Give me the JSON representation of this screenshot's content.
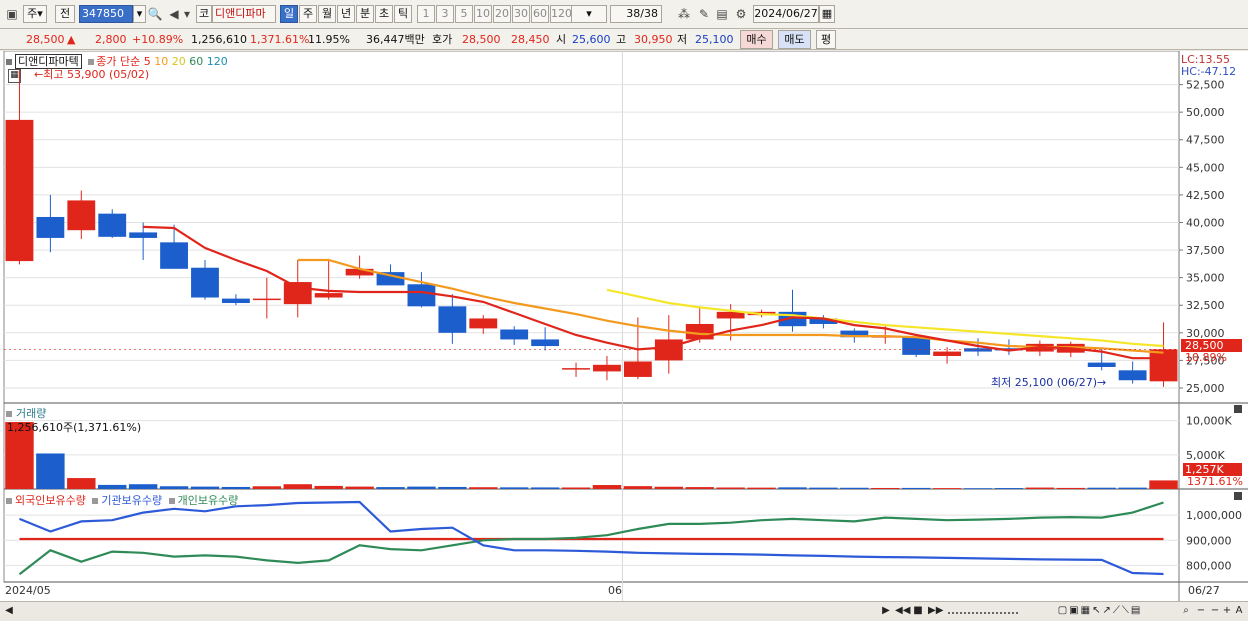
{
  "toolbar": {
    "period_label": "주",
    "prev_label": "전",
    "code_value": "347850",
    "market_label": "코",
    "stock_name": "디앤디파마",
    "timeframes": [
      "일",
      "주",
      "월",
      "년",
      "분",
      "초",
      "틱"
    ],
    "active_timeframe": "일",
    "intervals": [
      "1",
      "3",
      "5",
      "10",
      "20",
      "30",
      "60",
      "120"
    ],
    "count_display": "38/38",
    "date_value": "2024/06/27"
  },
  "quote": {
    "price": "28,500",
    "change": "2,800",
    "change_pct": "+10.89%",
    "volume": "1,256,610",
    "volume_pct": "1,371.61%",
    "turnover": "11.95%",
    "amount": "36,447백만",
    "bid_label": "호가",
    "bid1": "28,500",
    "bid2": "28,450",
    "open_label": "시",
    "open": "25,600",
    "high_label": "고",
    "high": "30,950",
    "low_label": "저",
    "low": "25,100",
    "buy_label": "매수",
    "sell_label": "매도",
    "eval_label": "평"
  },
  "legend": {
    "stock": "디앤디파마텍",
    "ma_label": "종가 단순",
    "ma_periods": [
      "5",
      "10",
      "20",
      "60",
      "120"
    ],
    "max_note": "최고 53,900 (05/02)",
    "min_note": "최저 25,100 (06/27)",
    "lc": "LC:13.55",
    "hc": "HC:-47.12",
    "last_price_tag": "28,500",
    "last_pct_tag": "10.89%",
    "volume_title": "거래량",
    "volume_note": "1,256,610주(1,371.61%)",
    "vol_tag": "1,257K",
    "vol_pct_tag": "1371.61%",
    "holdings": [
      "외국인보유수량",
      "기관보유수량",
      "개인보유수량"
    ]
  },
  "axis": {
    "price_ticks": [
      "52,500",
      "50,000",
      "47,500",
      "45,000",
      "42,500",
      "40,000",
      "37,500",
      "35,000",
      "32,500",
      "30,000",
      "27,500",
      "25,000"
    ],
    "volume_ticks": [
      "10,000K",
      "5,000K"
    ],
    "holding_ticks": [
      "1,000,000",
      "900,000",
      "800,000"
    ],
    "date_left": "2024/05",
    "date_mid": "06",
    "date_right": "06/27"
  },
  "colors": {
    "up": "#e0261b",
    "down": "#1c5fcc",
    "ma5": "#e0261b",
    "ma10": "#f39a1e",
    "ma20": "#f5e62a",
    "ma60": "#2e8b57",
    "ma120": "#1c8fb0",
    "foreign": "#2d5ad8",
    "institution": "#e0261b",
    "individual": "#2e8b57"
  },
  "chart_data": {
    "type": "candlestick",
    "dates": [
      "05/02",
      "05/03",
      "05/07",
      "05/08",
      "05/09",
      "05/10",
      "05/13",
      "05/14",
      "05/16",
      "05/17",
      "05/20",
      "05/21",
      "05/22",
      "05/23",
      "05/24",
      "05/27",
      "05/28",
      "05/29",
      "05/30",
      "05/31",
      "06/03",
      "06/04",
      "06/05",
      "06/07",
      "06/10",
      "06/11",
      "06/12",
      "06/13",
      "06/14",
      "06/17",
      "06/18",
      "06/19",
      "06/20",
      "06/21",
      "06/24",
      "06/25",
      "06/26",
      "06/27"
    ],
    "open": [
      36500,
      40500,
      39300,
      40800,
      39100,
      38200,
      35900,
      33100,
      33000,
      32600,
      33200,
      35200,
      35500,
      34400,
      32400,
      30400,
      30300,
      29400,
      26700,
      26500,
      26000,
      27500,
      29400,
      31300,
      31600,
      31900,
      31300,
      30200,
      29700,
      29600,
      27900,
      28600,
      28600,
      28300,
      28200,
      27300,
      26600,
      25600
    ],
    "high": [
      53900,
      42500,
      42900,
      41200,
      40000,
      39800,
      36600,
      33500,
      35000,
      36600,
      36700,
      37000,
      36200,
      35500,
      33500,
      31600,
      30600,
      30500,
      27300,
      27900,
      31400,
      31600,
      32400,
      32600,
      32100,
      33900,
      31600,
      30400,
      30700,
      29600,
      28700,
      29500,
      29400,
      29300,
      29200,
      28600,
      27400,
      30950
    ],
    "low": [
      36200,
      37300,
      38500,
      38600,
      36600,
      35900,
      33000,
      32500,
      31300,
      31400,
      33000,
      34900,
      34900,
      32300,
      29000,
      29900,
      28900,
      28400,
      26000,
      25700,
      25800,
      26300,
      29100,
      29300,
      31400,
      30100,
      30400,
      29100,
      29000,
      27800,
      27200,
      27900,
      28000,
      27900,
      27800,
      26600,
      25400,
      25100
    ],
    "close": [
      49300,
      38600,
      42000,
      38700,
      38600,
      35800,
      33200,
      32700,
      33100,
      34600,
      33600,
      35800,
      34300,
      32400,
      30000,
      31300,
      29400,
      28800,
      26800,
      27100,
      27400,
      29400,
      30800,
      31900,
      31900,
      30600,
      30800,
      29600,
      29700,
      28000,
      28300,
      28300,
      28400,
      29000,
      29000,
      26900,
      25700,
      28500
    ],
    "ma5": [
      null,
      null,
      null,
      null,
      39600,
      39500,
      37700,
      36600,
      35600,
      34100,
      33800,
      33700,
      33700,
      33700,
      33300,
      32800,
      31800,
      30800,
      29800,
      29100,
      28500,
      28700,
      29500,
      30200,
      30700,
      31400,
      31300,
      30700,
      30400,
      29800,
      29300,
      28800,
      28400,
      28700,
      28600,
      28300,
      27700,
      27700
    ],
    "ma10": [
      null,
      null,
      null,
      null,
      null,
      null,
      null,
      null,
      null,
      36600,
      36600,
      35800,
      35200,
      34600,
      34000,
      33300,
      32700,
      32200,
      31700,
      31100,
      30600,
      30200,
      29900,
      29800,
      29800,
      29800,
      29800,
      29700,
      29700,
      29600,
      29300,
      29100,
      28800,
      28700,
      28700,
      28600,
      28400,
      28200
    ],
    "ma20": [
      null,
      null,
      null,
      null,
      null,
      null,
      null,
      null,
      null,
      null,
      null,
      null,
      null,
      null,
      null,
      null,
      null,
      null,
      null,
      33900,
      33300,
      32700,
      32300,
      32000,
      31700,
      31600,
      31300,
      31000,
      30700,
      30500,
      30300,
      30100,
      29900,
      29700,
      29500,
      29300,
      29000,
      28800
    ],
    "volume": [
      9800,
      5200,
      1600,
      600,
      700,
      400,
      350,
      300,
      400,
      700,
      450,
      350,
      280,
      350,
      300,
      260,
      240,
      230,
      220,
      580,
      420,
      330,
      280,
      220,
      200,
      240,
      200,
      180,
      150,
      160,
      130,
      120,
      140,
      210,
      160,
      190,
      200,
      1257
    ],
    "holdings": {
      "foreign": [
        985000,
        935000,
        975000,
        980000,
        1010000,
        1025000,
        1015000,
        1035000,
        1040000,
        1048000,
        1050000,
        1052000,
        935000,
        945000,
        950000,
        880000,
        860000,
        860000,
        858000,
        855000,
        850000,
        848000,
        846000,
        845000,
        843000,
        840000,
        838000,
        835000,
        833000,
        832000,
        830000,
        828000,
        826000,
        824000,
        823000,
        822000,
        770000,
        766000
      ],
      "institution": [
        905000,
        905000,
        905000,
        905000,
        905000,
        905000,
        905000,
        905000,
        905000,
        905000,
        905000,
        905000,
        905000,
        905000,
        905000,
        905000,
        905000,
        905000,
        905000,
        905000,
        905000,
        905000,
        905000,
        905000,
        905000,
        905000,
        905000,
        905000,
        905000,
        905000,
        905000,
        905000,
        905000,
        905000,
        905000,
        905000,
        905000,
        905000
      ],
      "individual": [
        765000,
        860000,
        815000,
        855000,
        850000,
        835000,
        840000,
        835000,
        820000,
        810000,
        820000,
        880000,
        865000,
        860000,
        880000,
        900000,
        905000,
        905000,
        910000,
        920000,
        945000,
        965000,
        965000,
        970000,
        980000,
        985000,
        980000,
        975000,
        990000,
        985000,
        980000,
        982000,
        985000,
        990000,
        992000,
        990000,
        1010000,
        1050000
      ]
    },
    "ylim_price": [
      24000,
      55000
    ],
    "ylim_volume": [
      0,
      12000
    ],
    "ylim_holdings": [
      750000,
      1080000
    ]
  }
}
